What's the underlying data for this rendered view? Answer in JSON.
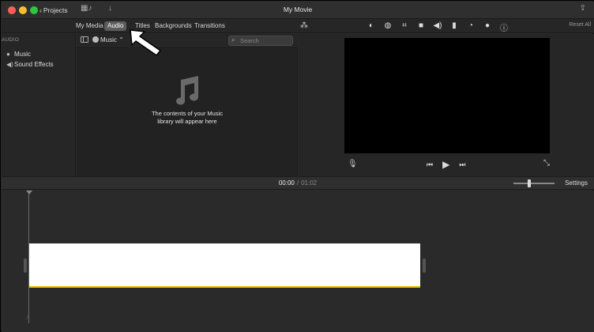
{
  "window": {
    "title": "My Movie",
    "projects_label": "Projects"
  },
  "tabs": [
    {
      "label": "My Media",
      "active": false
    },
    {
      "label": "Audio",
      "active": true
    },
    {
      "label": "Titles",
      "active": false
    },
    {
      "label": "Backgrounds",
      "active": false
    },
    {
      "label": "Transitions",
      "active": false
    }
  ],
  "viewer_toolbar": {
    "reset_all": "Reset All"
  },
  "sidebar": {
    "header": "AUDIO",
    "items": [
      {
        "label": "Music",
        "icon": "music-circle-icon"
      },
      {
        "label": "Sound Effects",
        "icon": "speaker-icon"
      }
    ]
  },
  "browser": {
    "source": "Music",
    "search_placeholder": "Search",
    "empty_message": "The contents of your Music\nlibrary will appear here"
  },
  "timeline": {
    "current_time": "00:00",
    "separator": "/",
    "total_time": "01:02",
    "settings_label": "Settings",
    "zoom_level": 0.38
  },
  "colors": {
    "accent_active_tab": "#5c5c5c",
    "clip_bottom": "#e8c300",
    "close": "#ff5f57",
    "minimize": "#febc2e",
    "zoom": "#28c840"
  }
}
